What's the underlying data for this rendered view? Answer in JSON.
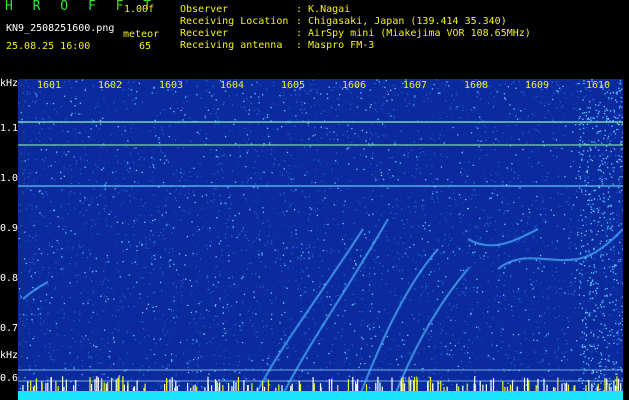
{
  "header": {
    "brand": "H R O F F T",
    "version": "1.00f",
    "filename": "KN9_2508251600.png",
    "meteor_label": "meteor",
    "datetime": "25.08.25 16:00",
    "meteor_count": "65"
  },
  "info": [
    {
      "label": "Observer",
      "value": ": K.Nagai"
    },
    {
      "label": "Receiving Location",
      "value": ": Chigasaki, Japan (139.414 35.340)"
    },
    {
      "label": "Receiver",
      "value": ": AirSpy mini (Miakejima VOR 108.65MHz)"
    },
    {
      "label": "Receiving antenna",
      "value": ": Maspro FM-3"
    }
  ],
  "axes": {
    "y_unit_top": "kHz",
    "y_unit_bottom": "kHz",
    "y_ticks": [
      "1.1",
      "1.0",
      "0.9",
      "0.8",
      "0.7",
      "0.6"
    ],
    "x_ticks": [
      "1601",
      "1602",
      "1603",
      "1604",
      "1605",
      "1606",
      "1607",
      "1608",
      "1609",
      "1610"
    ]
  },
  "colors": {
    "background": "#0a2a9e",
    "noise_hi": "#5fd0ff",
    "noise_lo": "#1f5fe0",
    "carrier": "#7fe0a0",
    "baseline": "#19e3ff"
  }
}
